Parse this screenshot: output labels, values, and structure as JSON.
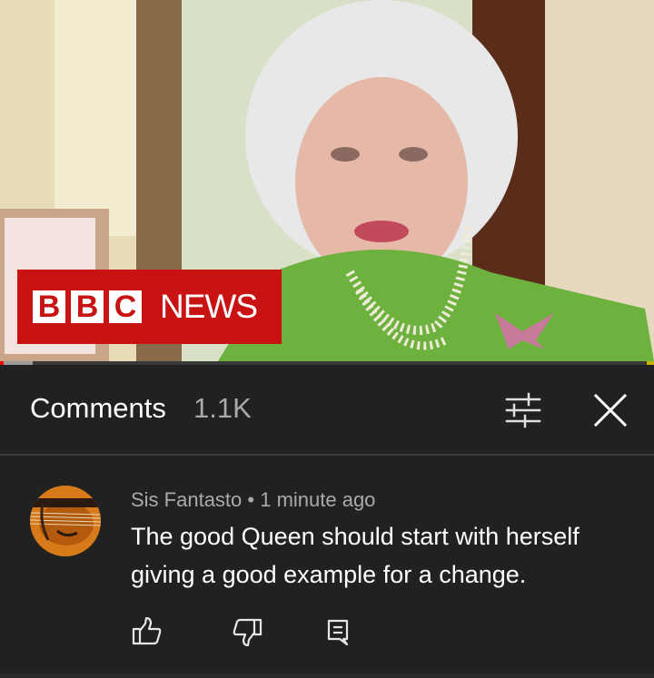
{
  "video": {
    "logo_letters": [
      "B",
      "B",
      "C"
    ],
    "logo_word": "NEWS",
    "progress_played": 0.005
  },
  "comments_header": {
    "title": "Comments",
    "count": "1.1K",
    "filter_icon": "sliders-icon",
    "close_icon": "close-icon"
  },
  "comment": {
    "author": "Sis Fantasto",
    "separator": " • ",
    "time": "1 minute ago",
    "text": "The good Queen should start with herself giving a good example for a change.",
    "actions": [
      "like-icon",
      "dislike-icon",
      "reply-icon"
    ]
  },
  "colors": {
    "background": "#212121",
    "brand_red": "#c91212",
    "secondary_text": "#aaaaaa",
    "progress": "#ff0000"
  }
}
